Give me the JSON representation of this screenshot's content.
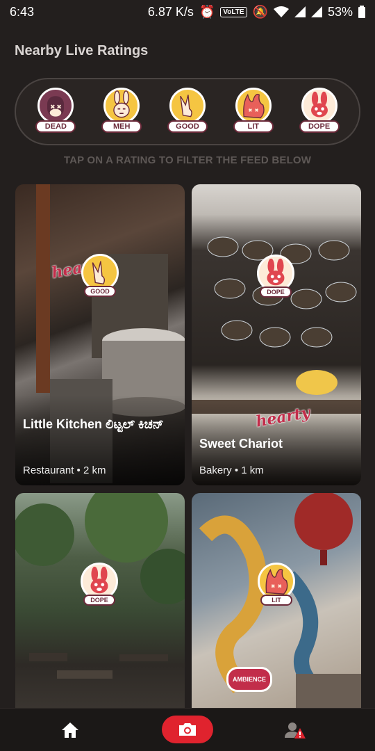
{
  "status_bar": {
    "time": "6:43",
    "speed": "6.87 K/s",
    "volte": "VoLTE",
    "battery": "53%"
  },
  "header": {
    "title": "Nearby Live Ratings"
  },
  "ratings": [
    {
      "label": "DEAD",
      "icon": "dead-bunny-icon",
      "color": "#7a3a52"
    },
    {
      "label": "MEH",
      "icon": "meh-bunny-icon",
      "color": "#f5c542"
    },
    {
      "label": "GOOD",
      "icon": "good-bunny-icon",
      "color": "#f5c542"
    },
    {
      "label": "LIT",
      "icon": "lit-bunny-icon",
      "color": "#f5c542"
    },
    {
      "label": "DOPE",
      "icon": "dope-bunny-icon",
      "color": "#fdebd8"
    }
  ],
  "hint": "TAP ON A RATING TO FILTER THE FEED BELOW",
  "feed": [
    {
      "name": "Little Kitchen ಲಿಟ್ಟಲ್ ಕಿಚನ್",
      "meta": "Restaurant • 2 km",
      "rating": "GOOD",
      "sticker": "hearty"
    },
    {
      "name": "Sweet Chariot",
      "meta": "Bakery • 1 km",
      "rating": "DOPE",
      "sticker": "hearty"
    },
    {
      "name": "",
      "meta": "",
      "rating": "DOPE",
      "sticker": ""
    },
    {
      "name": "",
      "meta": "",
      "rating": "LIT",
      "sticker": "AMBIENCE"
    }
  ],
  "nav": {
    "home_icon": "home-icon",
    "camera_icon": "camera-icon",
    "profile_icon": "profile-alert-icon",
    "accent": "#e0232e"
  }
}
